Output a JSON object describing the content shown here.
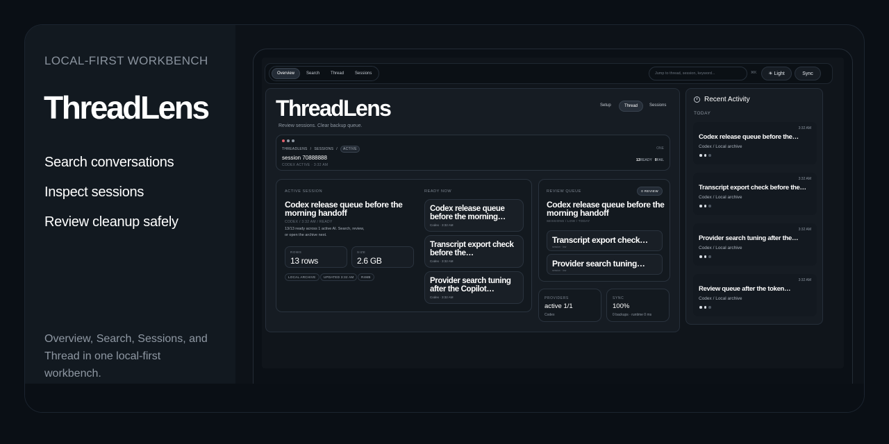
{
  "hero": {
    "eyebrow": "LOCAL-FIRST WORKBENCH",
    "brand": "ThreadLens",
    "features": [
      "Search conversations",
      "Inspect sessions",
      "Review cleanup safely"
    ],
    "description": "Overview, Search, Sessions, and Thread in one local-first workbench."
  },
  "topbar": {
    "nav": [
      {
        "label": "Overview",
        "active": true
      },
      {
        "label": "Search",
        "active": false
      },
      {
        "label": "Thread",
        "active": false
      },
      {
        "label": "Sessions",
        "active": false
      }
    ],
    "search_placeholder": "Jump to thread, session, keyword...",
    "shortcut": "⌘K",
    "light_label": "☀ Light",
    "sync_label": "Sync"
  },
  "main": {
    "title": "ThreadLens",
    "subtitle": "Review sessions. Clear backup queue.",
    "segments": [
      {
        "label": "Setup",
        "active": false
      },
      {
        "label": "Thread",
        "active": true
      },
      {
        "label": "Sessions",
        "active": false
      }
    ]
  },
  "session_bar": {
    "crumbs": [
      "THREADLENS",
      "/",
      "SESSIONS",
      "/"
    ],
    "badge": "ACTIVE",
    "right_label": "ONE",
    "name": "session 70888888",
    "meta": "CODEX ACTIVE · 3:32 AM",
    "ready_count": "13",
    "ready_label": "READY",
    "fail_count": "0",
    "fail_label": "FAIL",
    "dot_colors": [
      "#e0606b",
      "#8f98a3",
      "#8f98a3"
    ]
  },
  "active_session": {
    "label": "ACTIVE SESSION",
    "title": "Codex release queue before the morning handoff",
    "meta": "CODEX / 3:32 AM / READY",
    "description": "13/13 ready across 1 active AI. Search, review, or open the archive next.",
    "stats": [
      {
        "label": "ROWS",
        "value": "13 rows"
      },
      {
        "label": "SIZE",
        "value": "2.6 GB"
      }
    ],
    "tags": [
      "LOCAL ARCHIVE",
      "UPDATED 3:32 AM",
      "R4MB"
    ]
  },
  "ready_now": {
    "label": "READY NOW",
    "items": [
      {
        "title": "Codex release queue before the morning…",
        "meta": "Codex · 3:32 AM"
      },
      {
        "title": "Transcript export check before the…",
        "meta": "Codex · 3:32 AM"
      },
      {
        "title": "Provider search tuning after the Copilot…",
        "meta": "Codex · 3:32 AM"
      }
    ]
  },
  "review_queue": {
    "label": "REVIEW QUEUE",
    "badge": "0 REVIEW",
    "title": "Codex release queue before the morning handoff",
    "meta": "SESSIONS / LOW / TODAY",
    "items": [
      {
        "title": "Transcript export check…",
        "meta": "session · low"
      },
      {
        "title": "Provider search tuning…",
        "meta": "session · low"
      }
    ]
  },
  "providers": {
    "label": "PROVIDERS",
    "value": "active 1/1",
    "meta": "Codex"
  },
  "sync_card": {
    "label": "SYNC",
    "value": "100%",
    "meta": "0 backups · runtime 0 ms"
  },
  "recent": {
    "title": "Recent Activity",
    "group": "TODAY",
    "items": [
      {
        "time": "3:32 AM",
        "title": "Codex release queue before the…",
        "meta": "Codex / Local archive"
      },
      {
        "time": "3:32 AM",
        "title": "Transcript export check before the…",
        "meta": "Codex / Local archive"
      },
      {
        "time": "3:32 AM",
        "title": "Provider search tuning after the…",
        "meta": "Codex / Local archive"
      },
      {
        "time": "3:32 AM",
        "title": "Review queue after the token…",
        "meta": "Codex / Local archive"
      }
    ]
  }
}
